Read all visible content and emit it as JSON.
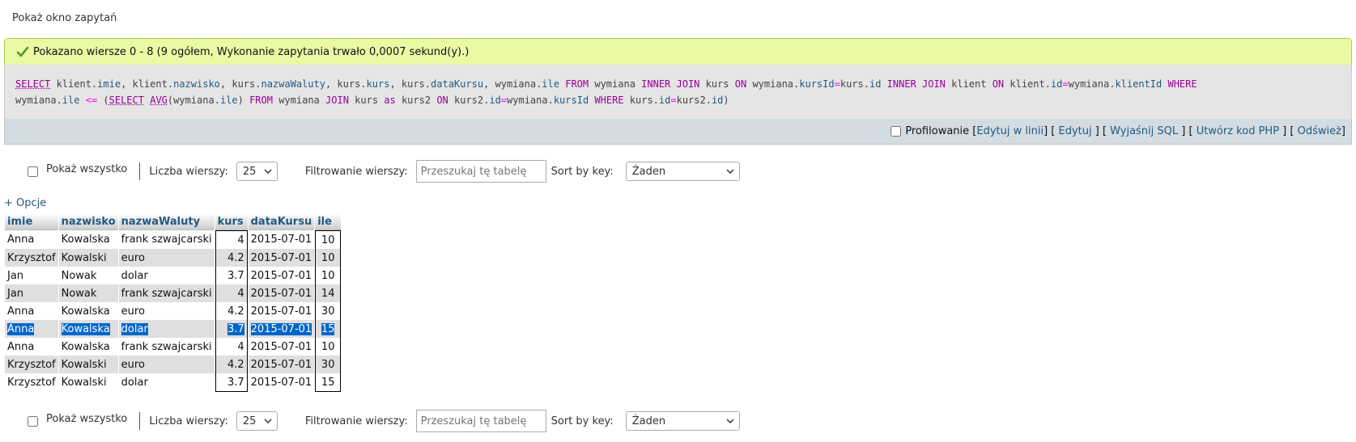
{
  "top_link": "Pokaż okno zapytań",
  "success_message": "Pokazano wiersze 0 - 8 (9 ogółem, Wykonanie zapytania trwało 0,0007 sekund(y).)",
  "sql_toolbar": {
    "profiling": "Profilowanie",
    "links": [
      "Edytuj w linii",
      "Edytuj",
      "Wyjaśnij SQL",
      "Utwórz kod PHP",
      "Odśwież"
    ]
  },
  "nav": {
    "show_all": "Pokaż wszystko",
    "rows_label": "Liczba wierszy:",
    "rows_value": "25",
    "filter_label": "Filtrowanie wierszy:",
    "filter_placeholder": "Przeszukaj tę tabelę",
    "sort_label": "Sort by key:",
    "sort_value": "Żaden"
  },
  "options_link": "+ Opcje",
  "table": {
    "columns": [
      "imie",
      "nazwisko",
      "nazwaWaluty",
      "kurs",
      "dataKursu",
      "ile"
    ],
    "rows": [
      [
        "Anna",
        "Kowalska",
        "frank szwajcarski",
        "4",
        "2015-07-01",
        "10"
      ],
      [
        "Krzysztof",
        "Kowalski",
        "euro",
        "4.2",
        "2015-07-01",
        "10"
      ],
      [
        "Jan",
        "Nowak",
        "dolar",
        "3.7",
        "2015-07-01",
        "10"
      ],
      [
        "Jan",
        "Nowak",
        "frank szwajcarski",
        "4",
        "2015-07-01",
        "14"
      ],
      [
        "Anna",
        "Kowalska",
        "euro",
        "4.2",
        "2015-07-01",
        "30"
      ],
      [
        "Anna",
        "Kowalska",
        "dolar",
        "3.7",
        "2015-07-01",
        "15"
      ],
      [
        "Anna",
        "Kowalska",
        "frank szwajcarski",
        "4",
        "2015-07-01",
        "10"
      ],
      [
        "Krzysztof",
        "Kowalski",
        "euro",
        "4.2",
        "2015-07-01",
        "30"
      ],
      [
        "Krzysztof",
        "Kowalski",
        "dolar",
        "3.7",
        "2015-07-01",
        "15"
      ]
    ]
  },
  "sql": {
    "t": [
      "SELECT",
      " klient.",
      "imie",
      ", klient.",
      "nazwisko",
      ", kurs.",
      "nazwaWaluty",
      ", kurs.",
      "kurs",
      ", kurs.",
      "dataKursu",
      ", wymiana.",
      "ile",
      " ",
      "FROM",
      " wymiana ",
      "INNER JOIN",
      " kurs ",
      "ON",
      " wymiana.",
      "kursId",
      "=",
      "kurs.",
      "id",
      " ",
      "INNER JOIN",
      " klient ",
      "ON",
      " klient.",
      "id",
      "=",
      "wymiana.",
      "klientId",
      " ",
      "WHERE",
      "\nwymiana.",
      "ile",
      " ",
      "<=",
      " (",
      "SELECT",
      " ",
      "AVG",
      "(wymiana.",
      "ile",
      ") ",
      "FROM",
      " wymiana ",
      "JOIN",
      " kurs ",
      "as",
      " kurs2 ",
      "ON",
      " kurs2.",
      "id",
      "=",
      "wymiana.",
      "kursId",
      " ",
      "WHERE",
      " kurs.",
      "id",
      "=",
      "kurs2.",
      "id",
      ")"
    ]
  },
  "colors": {
    "success_bg": "#ebf8a4",
    "header_text": "#235a81",
    "selection": "#0066cc"
  }
}
